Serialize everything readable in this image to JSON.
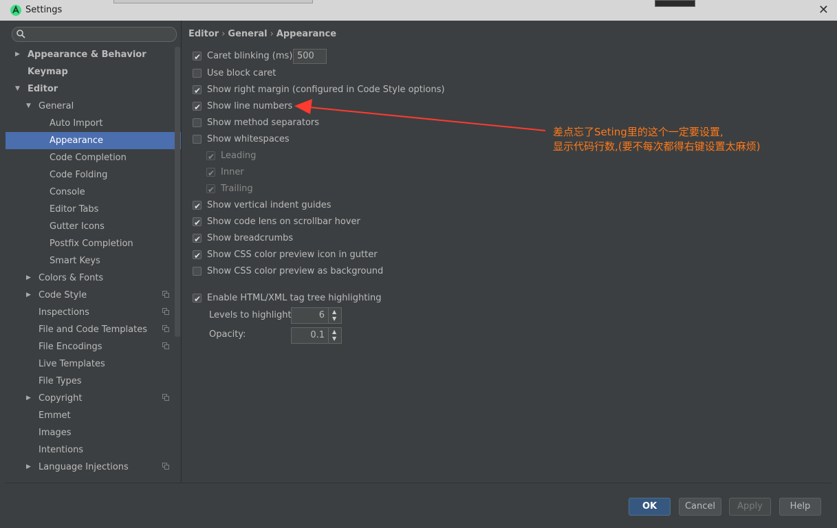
{
  "window": {
    "title": "Settings",
    "close_glyph": "✕"
  },
  "icons": {
    "app": "android-studio-icon",
    "search": "search-icon",
    "copy": "copy-icon"
  },
  "sidebar": {
    "search_placeholder": "",
    "items": [
      {
        "label": "Appearance & Behavior",
        "level": 0,
        "arrow": "right",
        "bold": true
      },
      {
        "label": "Keymap",
        "level": 0,
        "bold": true
      },
      {
        "label": "Editor",
        "level": 0,
        "arrow": "down",
        "bold": true
      },
      {
        "label": "General",
        "level": 1,
        "arrow": "down"
      },
      {
        "label": "Auto Import",
        "level": 2
      },
      {
        "label": "Appearance",
        "level": 2,
        "selected": true
      },
      {
        "label": "Code Completion",
        "level": 2
      },
      {
        "label": "Code Folding",
        "level": 2
      },
      {
        "label": "Console",
        "level": 2
      },
      {
        "label": "Editor Tabs",
        "level": 2
      },
      {
        "label": "Gutter Icons",
        "level": 2
      },
      {
        "label": "Postfix Completion",
        "level": 2
      },
      {
        "label": "Smart Keys",
        "level": 2
      },
      {
        "label": "Colors & Fonts",
        "level": 1,
        "arrow": "right"
      },
      {
        "label": "Code Style",
        "level": 1,
        "arrow": "right",
        "copy": true
      },
      {
        "label": "Inspections",
        "level": 1,
        "copy": true
      },
      {
        "label": "File and Code Templates",
        "level": 1,
        "copy": true
      },
      {
        "label": "File Encodings",
        "level": 1,
        "copy": true
      },
      {
        "label": "Live Templates",
        "level": 1
      },
      {
        "label": "File Types",
        "level": 1
      },
      {
        "label": "Copyright",
        "level": 1,
        "arrow": "right",
        "copy": true
      },
      {
        "label": "Emmet",
        "level": 1
      },
      {
        "label": "Images",
        "level": 1
      },
      {
        "label": "Intentions",
        "level": 1
      },
      {
        "label": "Language Injections",
        "level": 1,
        "arrow": "right",
        "copy": true
      }
    ]
  },
  "breadcrumb": {
    "part1": "Editor",
    "part2": "General",
    "part3": "Appearance",
    "sep": "›"
  },
  "options": {
    "caret_blinking": {
      "label": "Caret blinking (ms):",
      "checked": true,
      "value": "500"
    },
    "block_caret": {
      "label": "Use block caret",
      "checked": false
    },
    "right_margin": {
      "label": "Show right margin (configured in Code Style options)",
      "checked": true
    },
    "line_numbers": {
      "label": "Show line numbers",
      "checked": true
    },
    "method_separators": {
      "label": "Show method separators",
      "checked": false
    },
    "whitespaces": {
      "label": "Show whitespaces",
      "checked": false
    },
    "leading": {
      "label": "Leading",
      "checked": true
    },
    "inner": {
      "label": "Inner",
      "checked": true
    },
    "trailing": {
      "label": "Trailing",
      "checked": true
    },
    "indent_guides": {
      "label": "Show vertical indent guides",
      "checked": true
    },
    "code_lens": {
      "label": "Show code lens on scrollbar hover",
      "checked": true
    },
    "breadcrumbs": {
      "label": "Show breadcrumbs",
      "checked": true
    },
    "css_gutter": {
      "label": "Show CSS color preview icon in gutter",
      "checked": true
    },
    "css_background": {
      "label": "Show CSS color preview as background",
      "checked": false
    },
    "tag_tree": {
      "label": "Enable HTML/XML tag tree highlighting",
      "checked": true
    },
    "levels": {
      "label": "Levels to highlight:",
      "value": "6"
    },
    "opacity": {
      "label": "Opacity:",
      "value": "0.1"
    }
  },
  "annotation": {
    "line1": "差点忘了Seting里的这个一定要设置,",
    "line2": "显示代码行数,(要不每次都得右键设置太麻烦)",
    "color": "#ff7a1a"
  },
  "buttons": {
    "ok": "OK",
    "cancel": "Cancel",
    "apply": "Apply",
    "help": "Help"
  },
  "colors": {
    "selection": "#4b6eaf",
    "primary_button": "#365880",
    "background": "#3c3f41"
  }
}
